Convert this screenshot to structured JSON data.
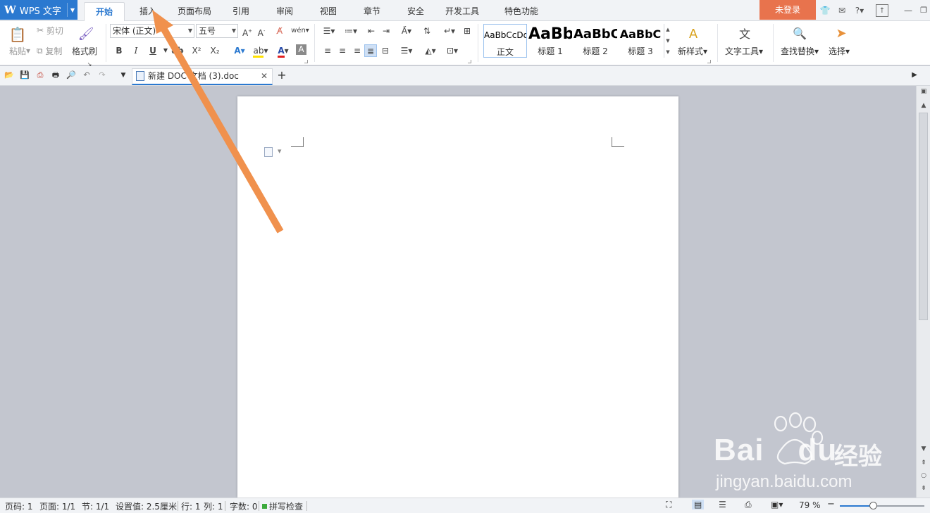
{
  "app": {
    "name": "WPS 文字"
  },
  "tabs": [
    {
      "label": "开始",
      "active": true
    },
    {
      "label": "插入"
    },
    {
      "label": "页面布局"
    },
    {
      "label": "引用"
    },
    {
      "label": "审阅"
    },
    {
      "label": "视图"
    },
    {
      "label": "章节"
    },
    {
      "label": "安全"
    },
    {
      "label": "开发工具"
    },
    {
      "label": "特色功能"
    }
  ],
  "login_label": "未登录",
  "ribbon": {
    "paste": "粘贴",
    "cut": "剪切",
    "copy": "复制",
    "format_painter": "格式刷",
    "font_name": "宋体 (正文)",
    "font_size": "五号",
    "bold": "B",
    "italic": "I",
    "underline": "U",
    "strike": "ab",
    "superscript": "X²",
    "subscript": "X₂",
    "font_color_glyph": "A",
    "styles": [
      {
        "preview": "AaBbCcDd",
        "name": "正文"
      },
      {
        "preview": "AaBb",
        "name": "标题 1"
      },
      {
        "preview": "AaBbC",
        "name": "标题 2"
      },
      {
        "preview": "AaBbC",
        "name": "标题 3"
      }
    ],
    "new_style": "新样式",
    "text_tools": "文字工具",
    "find_replace": "查找替换",
    "select": "选择"
  },
  "document_tab": {
    "title": "新建 DOC 文档 (3).doc"
  },
  "status": {
    "page_code": "页码: 1",
    "pages": "页面: 1/1",
    "section": "节: 1/1",
    "setting": "设置值: 2.5厘米",
    "row": "行: 1",
    "col": "列: 1",
    "word_count": "字数: 0",
    "spell_check": "拼写检查",
    "zoom": "79 %",
    "zoom_fraction": 0.4
  },
  "watermark": {
    "brand": "Bai",
    "brand2": "du",
    "cn": "经验",
    "url": "jingyan.baidu.com"
  },
  "colors": {
    "accent": "#2b79d0",
    "login": "#e8734d",
    "arrow": "#f0914d"
  }
}
